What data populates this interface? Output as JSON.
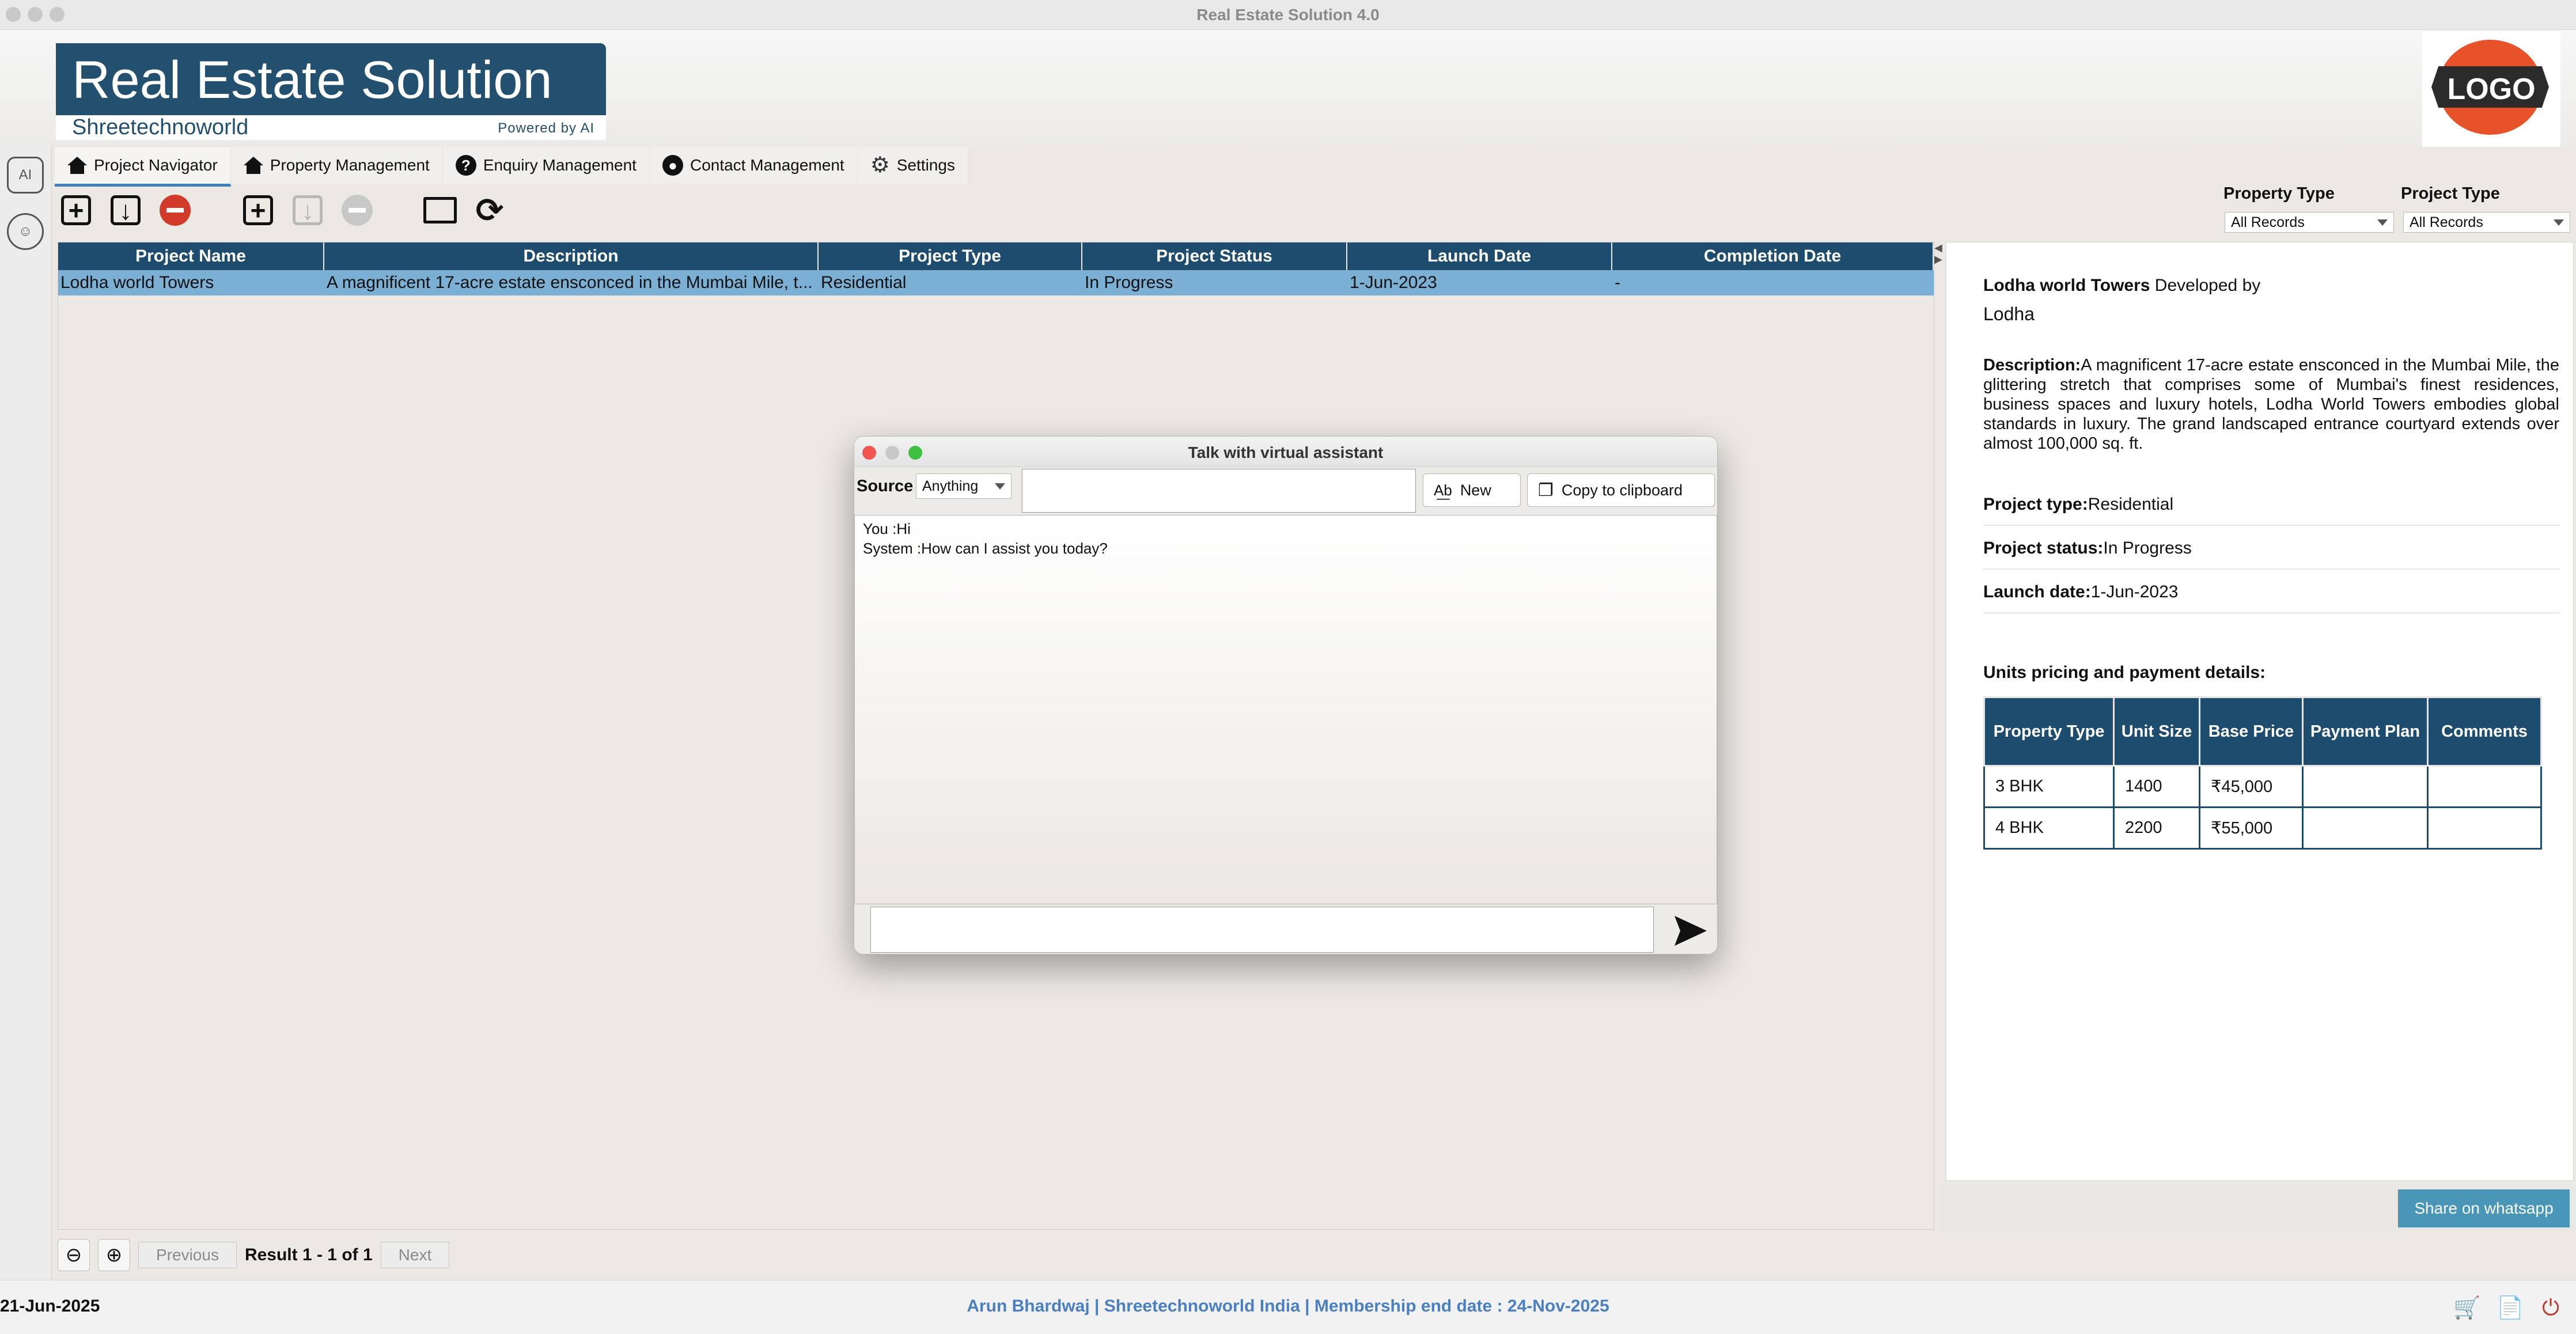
{
  "window": {
    "title": "Real Estate Solution 4.0"
  },
  "brand": {
    "title": "Real Estate Solution",
    "subtitle": "Shreetechnoworld",
    "powered": "Powered by AI",
    "logo_text": "LOGO"
  },
  "tabs": [
    {
      "label": "Project Navigator",
      "icon": "home-icon"
    },
    {
      "label": "Property Management",
      "icon": "home-icon"
    },
    {
      "label": "Enquiry Management",
      "icon": "help-icon"
    },
    {
      "label": "Contact Management",
      "icon": "person-icon"
    },
    {
      "label": "Settings",
      "icon": "gear-icon"
    }
  ],
  "filters": {
    "property_type": {
      "label": "Property Type",
      "value": "All Records"
    },
    "project_type": {
      "label": "Project Type",
      "value": "All Records"
    }
  },
  "grid": {
    "columns": [
      "Project Name",
      "Description",
      "Project Type",
      "Project Status",
      "Launch Date",
      "Completion Date"
    ],
    "rows": [
      [
        "Lodha world Towers",
        "A magnificent 17-acre estate ensconced in the Mumbai Mile, t...",
        "Residential",
        "In Progress",
        "1-Jun-2023",
        "-"
      ]
    ]
  },
  "details": {
    "project_name": "Lodha world Towers",
    "developed_by_label": "Developed by",
    "developer": "Lodha",
    "description_label": "Description:",
    "description": "A magnificent 17-acre estate ensconced in the Mumbai Mile, the glittering stretch that comprises some of Mumbai's finest residences, business spaces and luxury hotels, Lodha World Towers embodies global standards in luxury. The grand landscaped entrance courtyard extends over almost 100,000 sq. ft.",
    "project_type_label": "Project type:",
    "project_type": "Residential",
    "project_status_label": "Project status:",
    "project_status": "In Progress",
    "launch_date_label": "Launch date:",
    "launch_date": "1-Jun-2023",
    "units_heading": "Units pricing and payment details:",
    "units_columns": [
      "Property Type",
      "Unit Size",
      "Base Price",
      "Payment Plan",
      "Comments"
    ],
    "units": [
      [
        "3 BHK",
        "1400",
        "₹45,000",
        "",
        ""
      ],
      [
        "4 BHK",
        "2200",
        "₹55,000",
        "",
        ""
      ]
    ],
    "share_label": "Share on whatsapp"
  },
  "pager": {
    "previous": "Previous",
    "result": "Result 1 - 1 of 1",
    "next": "Next"
  },
  "status": {
    "date": "21-Jun-2025",
    "user_info": "Arun Bhardwaj | Shreetechnoworld India | Membership end date : 24-Nov-2025"
  },
  "chat": {
    "title": "Talk with virtual assistant",
    "source_label": "Source",
    "source_value": "Anything",
    "new_label": "New",
    "copy_label": "Copy to clipboard",
    "messages": [
      "You :Hi",
      "System :How can I assist you today?"
    ]
  },
  "colors": {
    "header_blue": "#1e4c6f",
    "selected_row": "#7bb0d4",
    "accent_link": "#4a7fc1",
    "remove_red": "#d23a2a"
  }
}
